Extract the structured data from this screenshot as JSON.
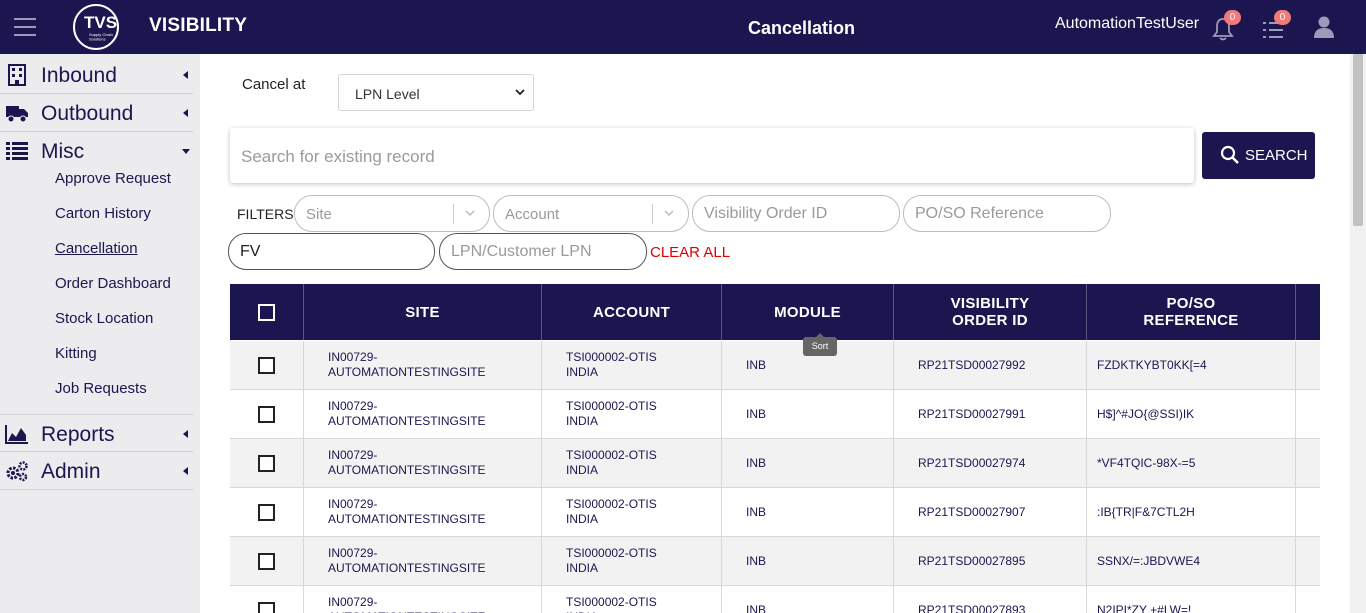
{
  "header": {
    "brand": "VISIBILITY",
    "logo_text": "TVS",
    "logo_subtext": "Supply Chain Solutions",
    "page_title": "Cancellation",
    "username": "AutomationTestUser",
    "notifications_count": "0",
    "tasks_count": "0",
    "colors": {
      "bar": "#1b1650",
      "badge": "#f07a7a"
    }
  },
  "sidebar": {
    "sections": [
      {
        "label": "Inbound",
        "icon": "building-icon"
      },
      {
        "label": "Outbound",
        "icon": "truck-icon"
      },
      {
        "label": "Misc",
        "icon": "list-icon"
      },
      {
        "label": "Reports",
        "icon": "area-chart-icon"
      },
      {
        "label": "Admin",
        "icon": "cogs-icon"
      }
    ],
    "misc_items": [
      {
        "label": "Approve Request"
      },
      {
        "label": "Carton History"
      },
      {
        "label": "Cancellation"
      },
      {
        "label": "Order Dashboard"
      },
      {
        "label": "Stock Location"
      },
      {
        "label": "Kitting"
      },
      {
        "label": "Job Requests"
      }
    ]
  },
  "form": {
    "cancel_at_label": "Cancel at",
    "cancel_at_value": "LPN Level",
    "search_placeholder": "Search for existing record",
    "search_button": "SEARCH",
    "filters_label": "FILTERS",
    "filter_site_placeholder": "Site",
    "filter_account_placeholder": "Account",
    "filter_order_id_placeholder": "Visibility Order ID",
    "filter_po_so_placeholder": "PO/SO Reference",
    "filter_fv_value": "FV",
    "filter_lpn_placeholder": "LPN/Customer LPN",
    "clear_all": "CLEAR ALL"
  },
  "table": {
    "headers": {
      "site": "SITE",
      "account": "ACCOUNT",
      "module": "MODULE",
      "order_id_1": "VISIBILITY",
      "order_id_2": "ORDER ID",
      "po_so_1": "PO/SO",
      "po_so_2": "REFERENCE"
    },
    "sort_tooltip": "Sort",
    "rows": [
      {
        "site_1": "IN00729-",
        "site_2": "AUTOMATIONTESTINGSITE",
        "account_1": "TSI000002-OTIS",
        "account_2": "INDIA",
        "module": "INB",
        "order_id": "RP21TSD00027992",
        "po_so": "FZDKTKYBT0KK[=4"
      },
      {
        "site_1": "IN00729-",
        "site_2": "AUTOMATIONTESTINGSITE",
        "account_1": "TSI000002-OTIS",
        "account_2": "INDIA",
        "module": "INB",
        "order_id": "RP21TSD00027991",
        "po_so": "H$]^#JO{@SSI)IK"
      },
      {
        "site_1": "IN00729-",
        "site_2": "AUTOMATIONTESTINGSITE",
        "account_1": "TSI000002-OTIS",
        "account_2": "INDIA",
        "module": "INB",
        "order_id": "RP21TSD00027974",
        "po_so": "*VF4TQIC-98X-=5"
      },
      {
        "site_1": "IN00729-",
        "site_2": "AUTOMATIONTESTINGSITE",
        "account_1": "TSI000002-OTIS",
        "account_2": "INDIA",
        "module": "INB",
        "order_id": "RP21TSD00027907",
        "po_so": ":IB{TR|F&7CTL2H"
      },
      {
        "site_1": "IN00729-",
        "site_2": "AUTOMATIONTESTINGSITE",
        "account_1": "TSI000002-OTIS",
        "account_2": "INDIA",
        "module": "INB",
        "order_id": "RP21TSD00027895",
        "po_so": "SSNX/=:JBDVWE4"
      },
      {
        "site_1": "IN00729-",
        "site_2": "AUTOMATIONTESTINGSITE",
        "account_1": "TSI000002-OTIS",
        "account_2": "INDIA",
        "module": "INB",
        "order_id": "RP21TSD00027893",
        "po_so": "N2IPI*ZY +#LW=!"
      }
    ]
  }
}
